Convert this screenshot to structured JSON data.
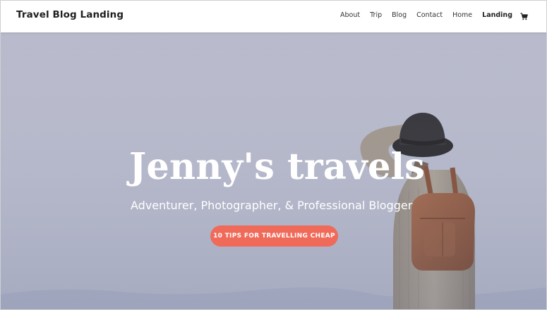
{
  "header": {
    "site_title": "Travel Blog Landing",
    "nav": [
      {
        "label": "About"
      },
      {
        "label": "Trip"
      },
      {
        "label": "Blog"
      },
      {
        "label": "Contact"
      },
      {
        "label": "Home"
      },
      {
        "label": "Landing",
        "active": true
      }
    ],
    "cart_icon": "cart-icon"
  },
  "hero": {
    "headline": "Jenny's travels",
    "subtitle": "Adventurer, Photographer, & Professional Blogger",
    "cta_label": "10 TIPS FOR TRAVELLING CHEAP"
  },
  "colors": {
    "accent": "#f06a5a",
    "sky": "#b7b9cb",
    "header_bg": "#ffffff"
  }
}
